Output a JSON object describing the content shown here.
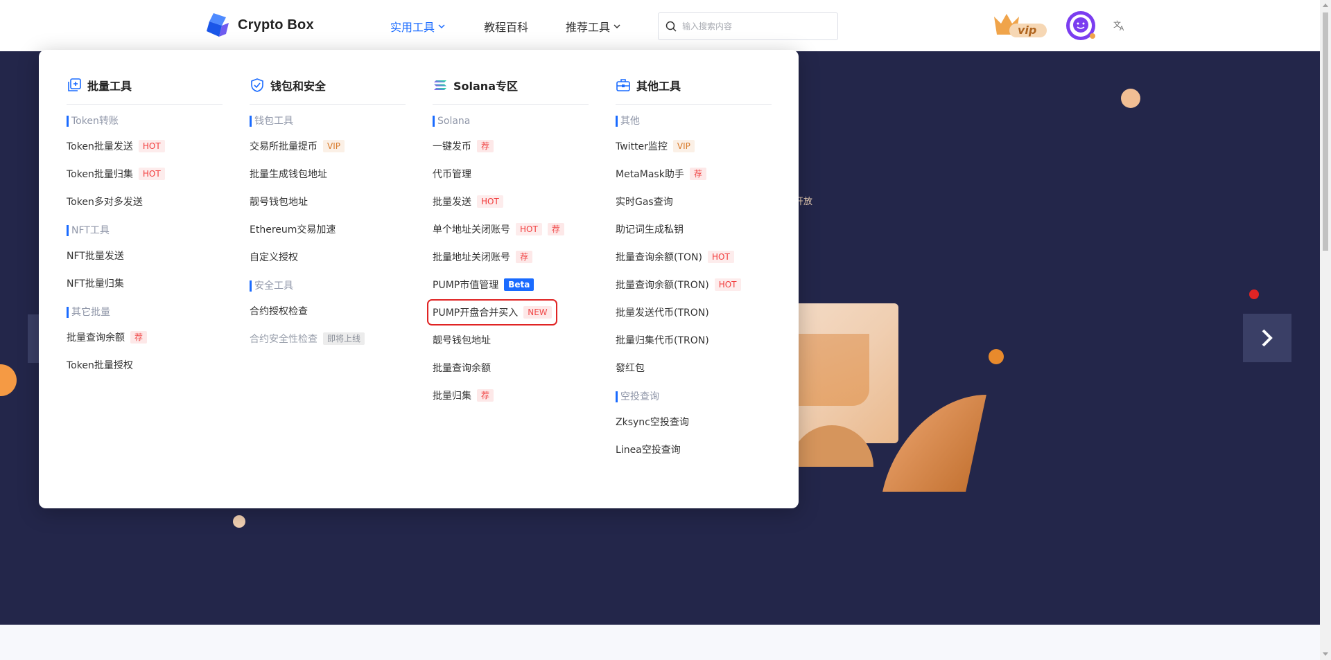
{
  "brand": {
    "name": "Crypto Box"
  },
  "nav": {
    "tools": "实用工具",
    "wiki": "教程百科",
    "recommended": "推荐工具"
  },
  "search": {
    "placeholder": "输入搜索内容"
  },
  "header_icons": {
    "vip": "vip",
    "avatar": "avatar-icon",
    "lang": "translate-icon"
  },
  "hero": {
    "partial_text": "开放"
  },
  "colors": {
    "accent": "#1a6bff",
    "hero_bg": "#23264a",
    "hot": "#f23b3b",
    "highlight": "#e02424"
  },
  "dropdown": {
    "columns": [
      {
        "title": "批量工具",
        "icon": "batch-plus-icon",
        "groups": [
          {
            "label": "Token转账",
            "items": [
              {
                "label": "Token批量发送",
                "tag": "HOT",
                "tag_type": "hot"
              },
              {
                "label": "Token批量归集",
                "tag": "HOT",
                "tag_type": "hot"
              },
              {
                "label": "Token多对多发送"
              }
            ]
          },
          {
            "label": "NFT工具",
            "items": [
              {
                "label": "NFT批量发送"
              },
              {
                "label": "NFT批量归集"
              }
            ]
          },
          {
            "label": "其它批量",
            "items": [
              {
                "label": "批量查询余额",
                "tag": "荐",
                "tag_type": "rec"
              },
              {
                "label": "Token批量授权"
              }
            ]
          }
        ]
      },
      {
        "title": "钱包和安全",
        "icon": "shield-check-icon",
        "groups": [
          {
            "label": "钱包工具",
            "items": [
              {
                "label": "交易所批量提币",
                "tag": "VIP",
                "tag_type": "vip"
              },
              {
                "label": "批量生成钱包地址"
              },
              {
                "label": "靓号钱包地址"
              },
              {
                "label": "Ethereum交易加速"
              },
              {
                "label": "自定义授权"
              }
            ]
          },
          {
            "label": "安全工具",
            "items": [
              {
                "label": "合约授权检查"
              },
              {
                "label": "合约安全性检查",
                "tag": "即将上线",
                "tag_type": "soon",
                "disabled": true
              }
            ]
          }
        ]
      },
      {
        "title": "Solana专区",
        "icon": "solana-icon",
        "groups": [
          {
            "label": "Solana",
            "items": [
              {
                "label": "一键发币",
                "tag": "荐",
                "tag_type": "rec"
              },
              {
                "label": "代币管理"
              },
              {
                "label": "批量发送",
                "tag": "HOT",
                "tag_type": "hot"
              },
              {
                "label": "单个地址关闭账号",
                "tag": "HOT",
                "tag_type": "hot",
                "tag2": "荐",
                "tag2_type": "rec"
              },
              {
                "label": "批量地址关闭账号",
                "tag": "荐",
                "tag_type": "rec"
              },
              {
                "label": "PUMP市值管理",
                "tag": "Beta",
                "tag_type": "beta"
              },
              {
                "label": "PUMP开盘合并买入",
                "tag": "NEW",
                "tag_type": "new",
                "highlighted": true
              },
              {
                "label": "靓号钱包地址"
              },
              {
                "label": "批量查询余额"
              },
              {
                "label": "批量归集",
                "tag": "荐",
                "tag_type": "rec"
              }
            ]
          }
        ]
      },
      {
        "title": "其他工具",
        "icon": "toolbox-icon",
        "groups": [
          {
            "label": "其他",
            "items": [
              {
                "label": "Twitter监控",
                "tag": "VIP",
                "tag_type": "vip"
              },
              {
                "label": "MetaMask助手",
                "tag": "荐",
                "tag_type": "rec"
              },
              {
                "label": "实时Gas查询"
              },
              {
                "label": "助记词生成私钥"
              },
              {
                "label": "批量查询余额(TON)",
                "tag": "HOT",
                "tag_type": "hot"
              },
              {
                "label": "批量查询余额(TRON)",
                "tag": "HOT",
                "tag_type": "hot"
              },
              {
                "label": "批量发送代币(TRON)"
              },
              {
                "label": "批量归集代币(TRON)"
              },
              {
                "label": "發红包"
              }
            ]
          },
          {
            "label": "空投查询",
            "items": [
              {
                "label": "Zksync空投查询"
              },
              {
                "label": "Linea空投查询"
              }
            ]
          }
        ]
      }
    ]
  }
}
